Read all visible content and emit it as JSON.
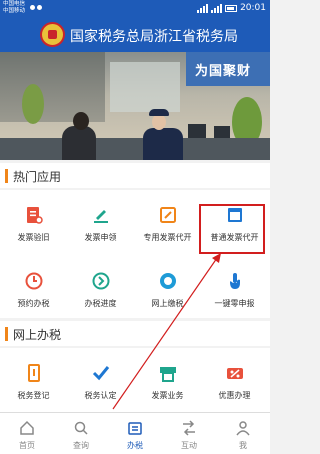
{
  "status_bar": {
    "carrier_line1": "中国电信",
    "carrier_line2": "中国移动",
    "time": "20:01"
  },
  "header": {
    "title": "国家税务总局浙江省税务局",
    "emblem_icon": "tax-emblem-icon"
  },
  "banner": {
    "sign_text": "为国聚财"
  },
  "hot_section": {
    "title": "热门应用",
    "accent": "#f08519",
    "items": [
      {
        "label": "发票验旧",
        "icon": "invoice-check-icon",
        "color": "#e8513c"
      },
      {
        "label": "发票申领",
        "icon": "pen-icon",
        "color": "#1fa58d"
      },
      {
        "label": "专用发票代开",
        "icon": "edit-square-icon",
        "color": "#f08519"
      },
      {
        "label": "普通发票代开",
        "icon": "window-icon",
        "color": "#1e77d2"
      },
      {
        "label": "预约办税",
        "icon": "clock-icon",
        "color": "#e8513c"
      },
      {
        "label": "办税进度",
        "icon": "progress-icon",
        "color": "#1fa58d"
      },
      {
        "label": "网上缴税",
        "icon": "tax-payment-icon",
        "color": "#1e9bd7"
      },
      {
        "label": "一键零申报",
        "icon": "tap-icon",
        "color": "#1e77d2"
      }
    ]
  },
  "online_section": {
    "title": "网上办税",
    "items": [
      {
        "label": "税务登记",
        "icon": "registration-icon",
        "color": "#f08519"
      },
      {
        "label": "税务认定",
        "icon": "checkmark-icon",
        "color": "#1e77d2"
      },
      {
        "label": "发票业务",
        "icon": "invoice-icon",
        "color": "#1fa58d"
      },
      {
        "label": "优惠办理",
        "icon": "discount-icon",
        "color": "#e8513c"
      }
    ]
  },
  "tab_bar": {
    "active_color": "#1e5bb8",
    "tabs": [
      {
        "label": "首页",
        "icon": "home-icon"
      },
      {
        "label": "查询",
        "icon": "search-icon"
      },
      {
        "label": "办税",
        "icon": "tax-service-icon"
      },
      {
        "label": "互动",
        "icon": "interact-icon"
      },
      {
        "label": "我",
        "icon": "user-icon"
      }
    ]
  }
}
